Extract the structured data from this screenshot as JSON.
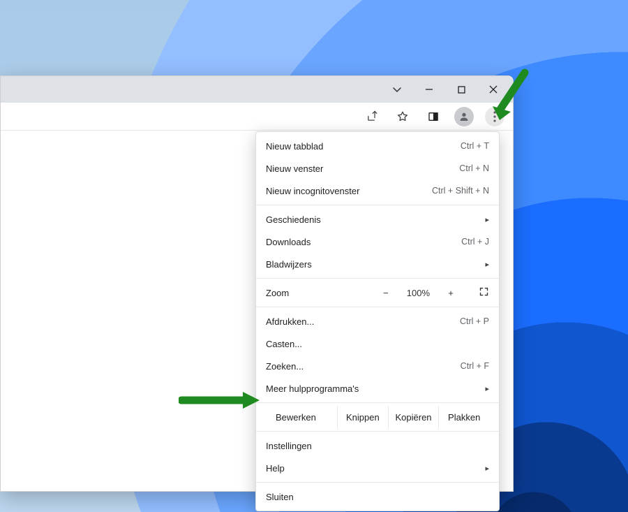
{
  "menu": {
    "new_tab": {
      "label": "Nieuw tabblad",
      "accel": "Ctrl + T"
    },
    "new_window": {
      "label": "Nieuw venster",
      "accel": "Ctrl + N"
    },
    "new_incognito": {
      "label": "Nieuw incognitovenster",
      "accel": "Ctrl + Shift + N"
    },
    "history": {
      "label": "Geschiedenis"
    },
    "downloads": {
      "label": "Downloads",
      "accel": "Ctrl + J"
    },
    "bookmarks": {
      "label": "Bladwijzers"
    },
    "zoom": {
      "label": "Zoom",
      "value": "100%"
    },
    "print": {
      "label": "Afdrukken...",
      "accel": "Ctrl + P"
    },
    "cast": {
      "label": "Casten..."
    },
    "find": {
      "label": "Zoeken...",
      "accel": "Ctrl + F"
    },
    "more_tools": {
      "label": "Meer hulpprogramma's"
    },
    "edit": {
      "label": "Bewerken",
      "cut": "Knippen",
      "copy": "Kopiëren",
      "paste": "Plakken"
    },
    "settings": {
      "label": "Instellingen"
    },
    "help": {
      "label": "Help"
    },
    "exit": {
      "label": "Sluiten"
    }
  }
}
